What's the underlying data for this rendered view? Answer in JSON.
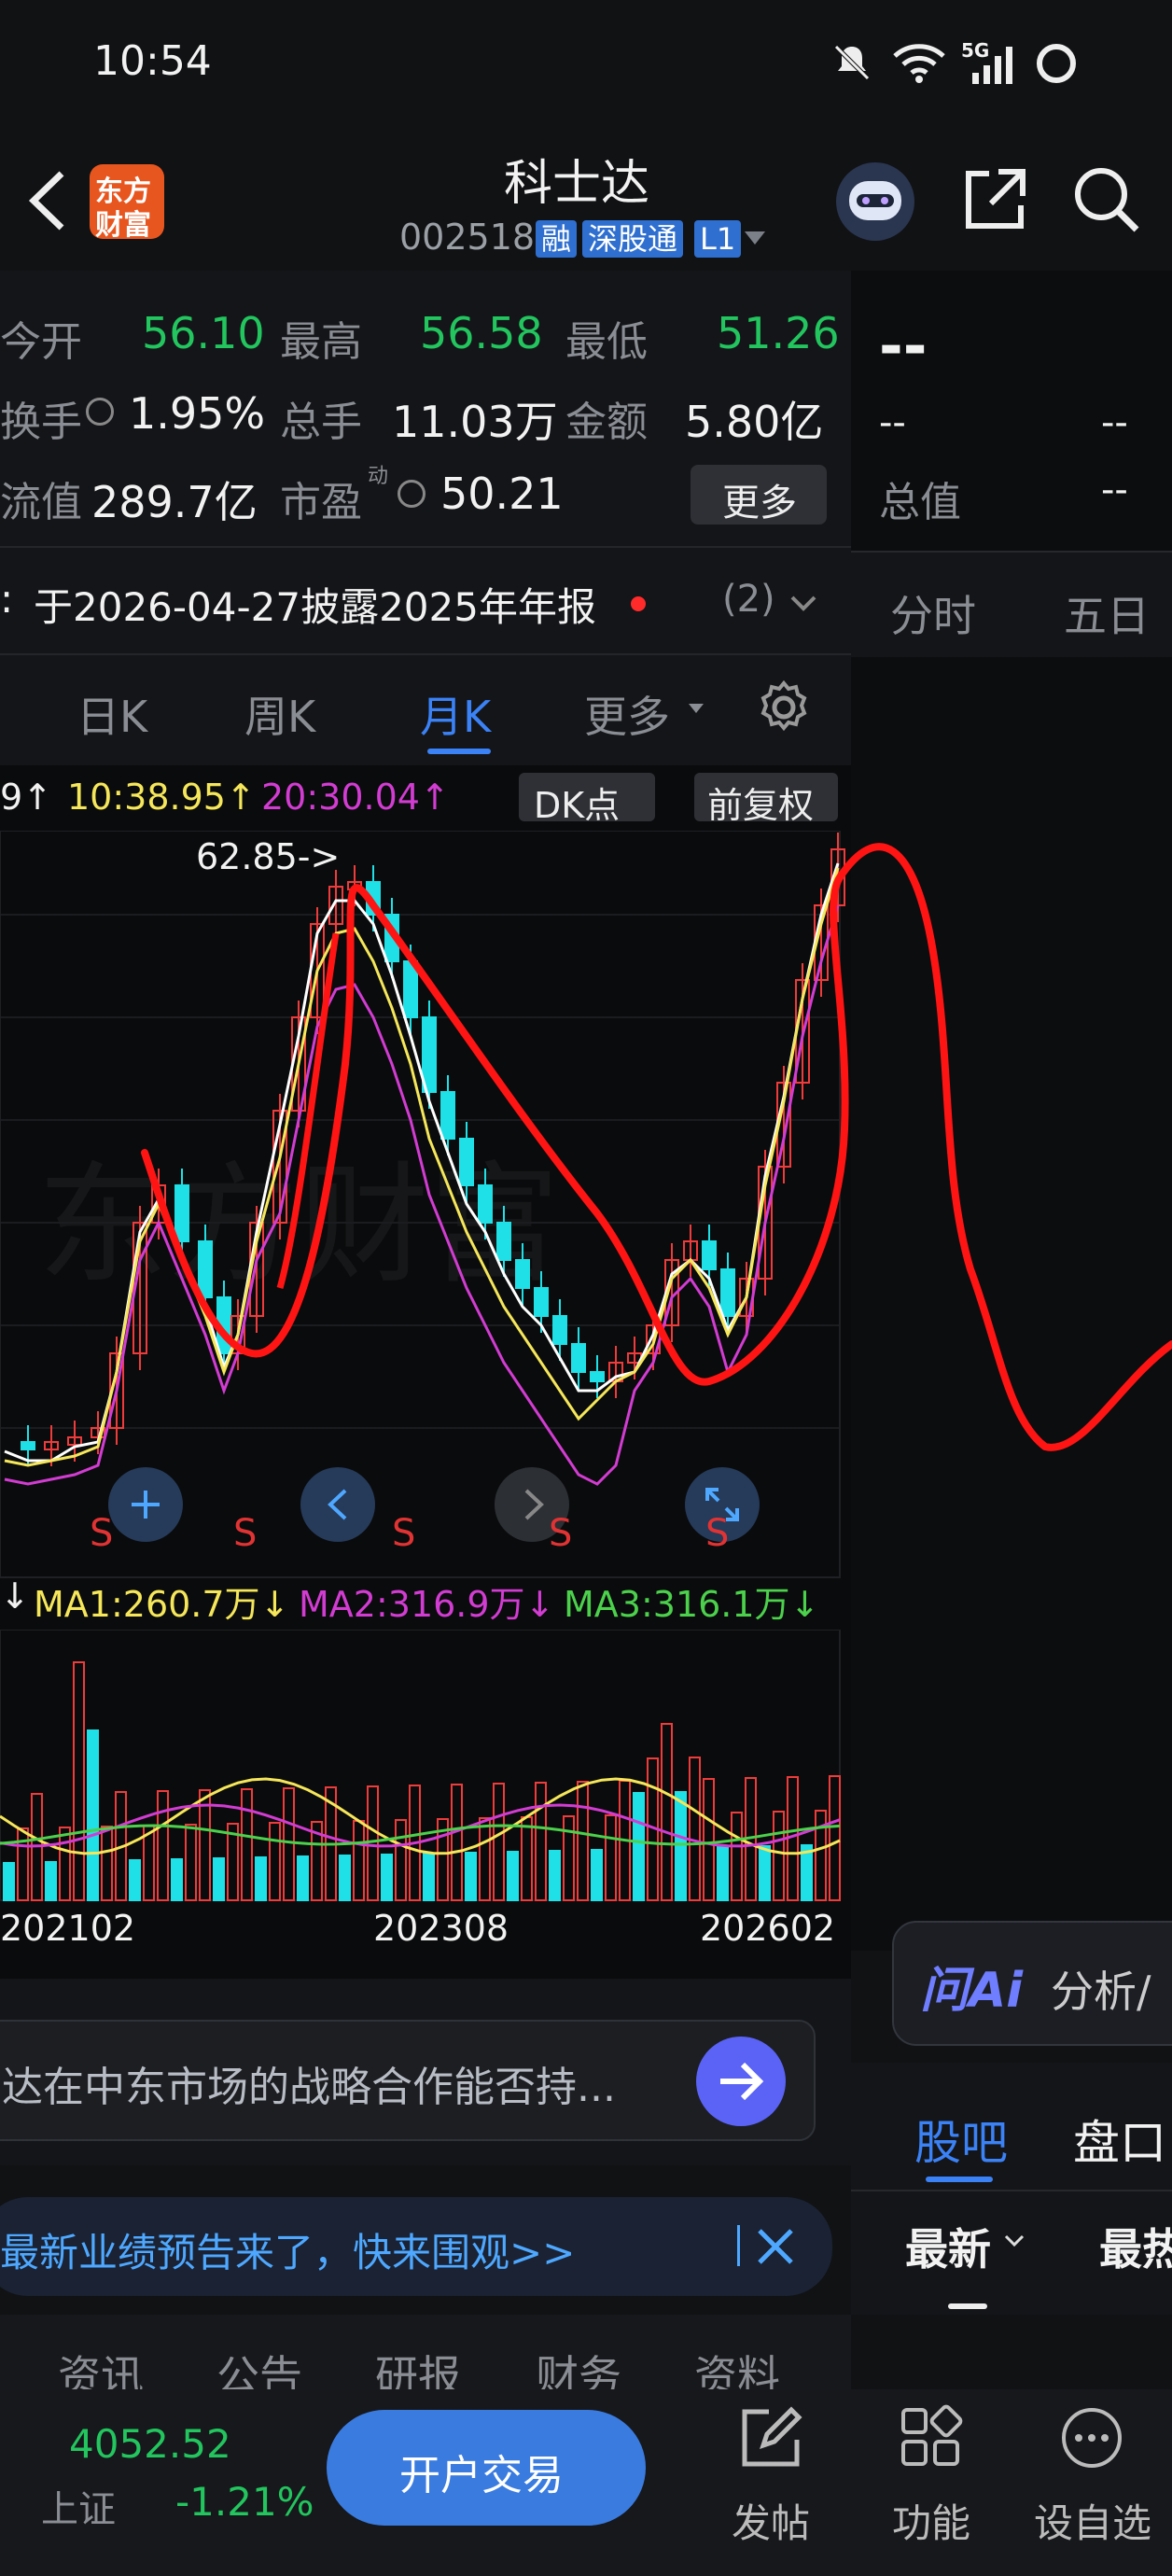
{
  "status": {
    "time": "10:54",
    "net": "5G"
  },
  "header": {
    "title": "科士达",
    "code": "002518",
    "badge_rong": "融",
    "badge_sgt": "深股通",
    "badge_l1": "L1",
    "logo_line1": "东方",
    "logo_line2": "财富"
  },
  "quote": {
    "open_label": "今开",
    "open": "56.10",
    "high_label": "最高",
    "high": "56.58",
    "low_label": "最低",
    "low": "51.26",
    "turnover_label": "换手",
    "turnover": "1.95%",
    "volume_label": "总手",
    "volume": "11.03万",
    "amount_label": "金额",
    "amount": "5.80亿",
    "float_label": "流值",
    "float": "289.7亿",
    "pe_label": "市盈",
    "pe_sup": "动",
    "pe": "50.21",
    "more_btn": "更多"
  },
  "notice": {
    "text": "于2026-04-27披露2025年年报",
    "count": "(2)"
  },
  "right_panel": {
    "price": "--",
    "r1a": "--",
    "r1b": "--",
    "total_label": "总值",
    "total": "--",
    "tab_fenshi": "分时",
    "tab_wuri": "五日",
    "ai_brand": "问Ai",
    "ai_text": "分析/",
    "tab_guba": "股吧",
    "tab_pankou": "盘口",
    "sort_new": "最新",
    "sort_hot": "最热"
  },
  "tabs": {
    "day": "日K",
    "week": "周K",
    "month": "月K",
    "more": "更多"
  },
  "chart_info": {
    "t1": "9↑",
    "t2": "10:38.95↑",
    "t3": "20:30.04↑",
    "dk_btn": "DK点",
    "adj_btn": "前复权",
    "peak_label": "62.85->",
    "s_marks": [
      "S",
      "S",
      "S",
      "S",
      "S"
    ],
    "vol_head0": "↓",
    "ma1": "MA1:260.7万↓",
    "ma2": "MA2:316.9万↓",
    "ma3": "MA3:316.1万↓",
    "x_labels": [
      "202102",
      "202308",
      "202602"
    ],
    "watermark": "东方财富"
  },
  "colors": {
    "up": "#ef3b3b",
    "down": "#1fe0e6",
    "ma_white": "#ffffff",
    "ma_yellow": "#f5e65a",
    "ma_magenta": "#d23cd2",
    "ma_green": "#4cd14c",
    "annot": "#ff1010"
  },
  "chart_data": {
    "type": "candlestick",
    "x_labels": [
      "202102",
      "202308",
      "202602"
    ],
    "peak_price": 62.85,
    "volume_ma": {
      "MA1": "260.7万",
      "MA2": "316.9万",
      "MA3": "316.1万"
    }
  },
  "ask": {
    "placeholder": "达在中东市场的战略合作能否持..."
  },
  "banner": {
    "text": "最新业绩预告来了，快来围观>>"
  },
  "news_tabs": [
    "资讯",
    "公告",
    "研报",
    "财务",
    "资料"
  ],
  "bottom": {
    "index_value": "4052.52",
    "index_name": "上证",
    "index_chg": "-1.21%",
    "open_btn": "开户交易",
    "post": "发帖",
    "func": "功能",
    "watch": "设自选"
  }
}
